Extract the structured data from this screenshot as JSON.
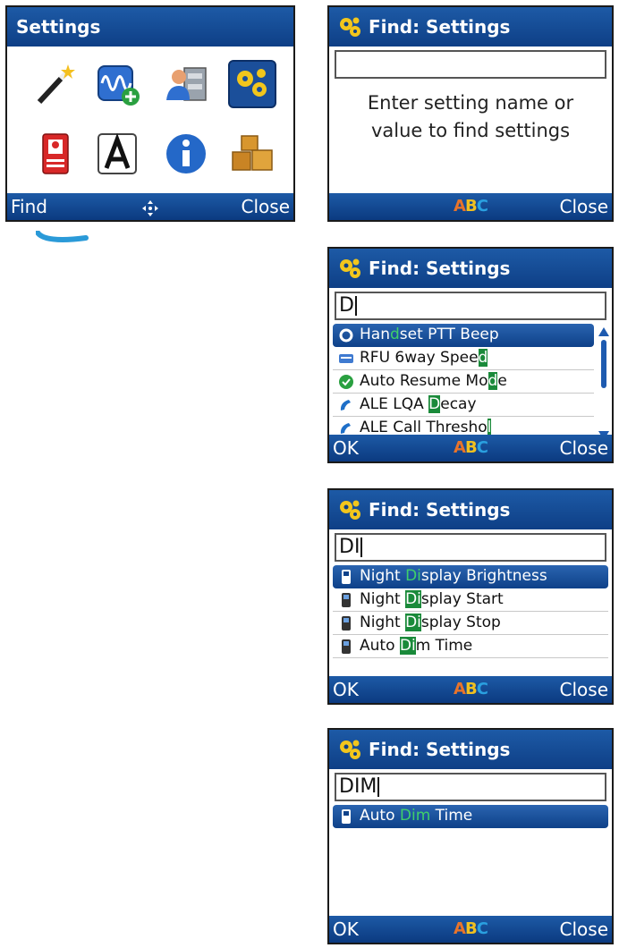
{
  "screen_main": {
    "title": "Settings",
    "soft_left": "Find",
    "soft_right": "Close",
    "icons": [
      "wand-icon",
      "waveform-add-icon",
      "user-cabinet-icon",
      "gears-icon",
      "id-badge-icon",
      "font-a-icon",
      "info-icon",
      "boxes-icon"
    ]
  },
  "find_empty": {
    "title": "Find: Settings",
    "input": "",
    "hint_line1": "Enter setting name or",
    "hint_line2": "value to find settings",
    "soft_right": "Close",
    "abc": [
      "A",
      "B",
      "C"
    ]
  },
  "find_d": {
    "title": "Find: Settings",
    "input": "D",
    "soft_left": "OK",
    "soft_right": "Close",
    "items": [
      {
        "pre": "Han",
        "match": "d",
        "post": "set PTT Beep"
      },
      {
        "pre": "RFU 6way Spee",
        "match": "d",
        "post": ""
      },
      {
        "pre": "Auto Resume Mo",
        "match": "d",
        "post": "e"
      },
      {
        "pre": "ALE LQA ",
        "match": "D",
        "post": "ecay"
      },
      {
        "pre": "ALE Call Thresho",
        "match": "l",
        "post": ""
      }
    ]
  },
  "find_di": {
    "title": "Find: Settings",
    "input": "DI",
    "soft_left": "OK",
    "soft_right": "Close",
    "items": [
      {
        "pre": "Night ",
        "match": "Di",
        "post": "splay Brightness"
      },
      {
        "pre": "Night ",
        "match": "Di",
        "post": "splay Start"
      },
      {
        "pre": "Night ",
        "match": "Di",
        "post": "splay Stop"
      },
      {
        "pre": "Auto ",
        "match": "Di",
        "post": "m Time"
      }
    ]
  },
  "find_dim": {
    "title": "Find: Settings",
    "input": "DIM",
    "soft_left": "OK",
    "soft_right": "Close",
    "items": [
      {
        "pre": "Auto ",
        "match": "Dim",
        "post": " Time"
      }
    ]
  },
  "colors": {
    "title_bar": "#0e3f86",
    "match_highlight": "#1a8a3a",
    "selected_match": "#3fd06a"
  }
}
